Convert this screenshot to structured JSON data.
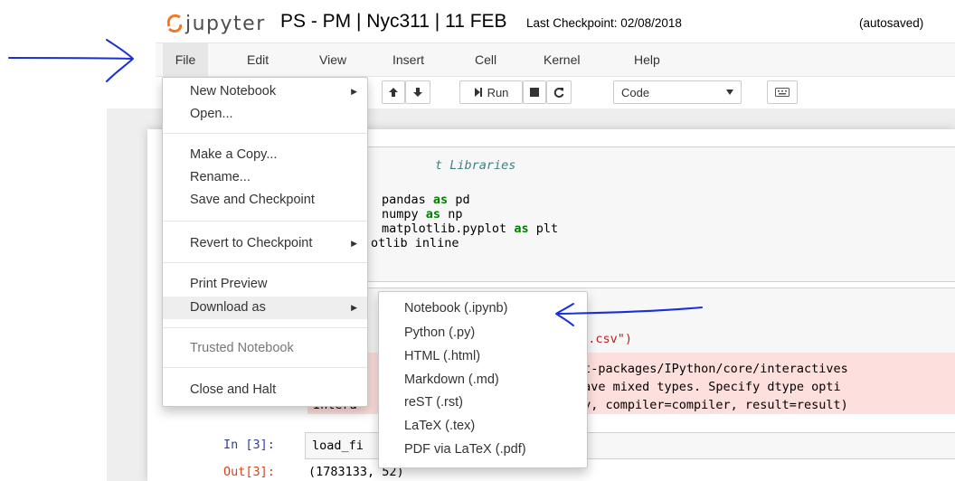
{
  "header": {
    "logo_text": "jupyter",
    "notebook_name": "PS - PM | Nyc311 | 11 FEB",
    "checkpoint": "Last Checkpoint: 02/08/2018",
    "autosave_status": "(autosaved)"
  },
  "menubar": {
    "items": [
      "File",
      "Edit",
      "View",
      "Insert",
      "Cell",
      "Kernel",
      "Help"
    ]
  },
  "toolbar": {
    "run_label": "Run",
    "cell_type": "Code",
    "icons": [
      "arrow-up-icon",
      "arrow-down-icon",
      "step-forward-icon",
      "stop-icon",
      "restart-icon",
      "chevron-down-icon",
      "keyboard-icon"
    ]
  },
  "file_menu": {
    "new_notebook": "New Notebook",
    "open": "Open...",
    "make_copy": "Make a Copy...",
    "rename": "Rename...",
    "save_checkpoint": "Save and Checkpoint",
    "revert_checkpoint": "Revert to Checkpoint",
    "print_preview": "Print Preview",
    "download_as": "Download as",
    "trusted_notebook": "Trusted Notebook",
    "close_halt": "Close and Halt"
  },
  "download_submenu": {
    "items": [
      "Notebook (.ipynb)",
      "Python (.py)",
      "HTML (.html)",
      "Markdown (.md)",
      "reST (.rst)",
      "LaTeX (.tex)",
      "PDF via LaTeX (.pdf)"
    ]
  },
  "cell1": {
    "comment": "t Libraries",
    "line2_name": "pandas",
    "line2_as": "as",
    "line2_alias": "pd",
    "line3_name": "numpy",
    "line3_as": "as",
    "line3_alias": "np",
    "line4_name": "matplotlib.pyplot",
    "line4_as": "as",
    "line4_alias": "plt",
    "line5": "otlib inline"
  },
  "cell2": {
    "string_frag": "ta.csv\")"
  },
  "stderr": {
    "line1": "st-packages/IPython/core/interactives",
    "line2": "have mixed types. Specify dtype opti",
    "line3_left": "Intera",
    "line3_right": "ty, compiler=compiler, result=result)"
  },
  "cell3": {
    "in_prompt": "In [3]:",
    "in_code": "load_fi",
    "out_prompt": "Out[3]:",
    "out_value": "(1783133, 52)"
  },
  "annotation_colors": {
    "arrow": "#1a2fd6"
  },
  "colors": {
    "menubar_bg": "#f7f7f7",
    "stderr_bg": "#fddfdd",
    "in_prompt": "#303f9f",
    "out_prompt": "#d84315"
  }
}
